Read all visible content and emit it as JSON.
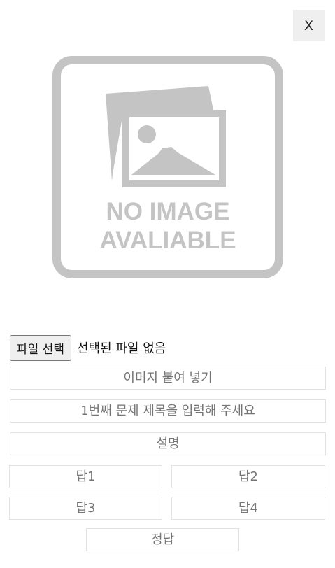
{
  "close_button": {
    "label": "X"
  },
  "placeholder_image": {
    "line1": "NO IMAGE",
    "line2": "AVALIABLE",
    "icon": "image-placeholder-icon",
    "color": "#c4c4c4"
  },
  "file_input": {
    "button_label": "파일 선택",
    "status": "선택된 파일 없음"
  },
  "fields": {
    "paste_image": "이미지 붙여 넣기",
    "question_title": "1번째 문제 제목을 입력해 주세요",
    "description": "설명",
    "answer1": "답1",
    "answer2": "답2",
    "answer3": "답3",
    "answer4": "답4",
    "correct_answer": "정답"
  }
}
